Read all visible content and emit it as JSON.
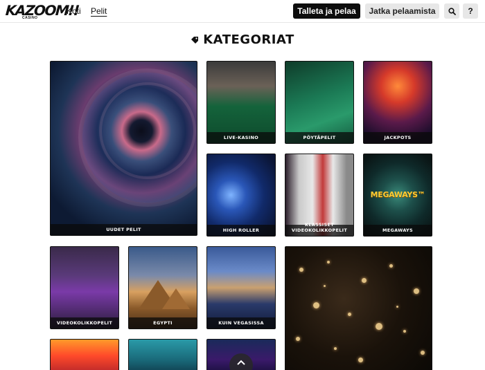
{
  "header": {
    "logo_text": "KAZOOM!!",
    "logo_sub": "CASINO",
    "nav": [
      {
        "label": "Koti"
      },
      {
        "label": "Pelit"
      }
    ],
    "deposit_button": "Talleta ja pelaa",
    "continue_button": "Jatka pelaamista",
    "search_icon": "search-icon",
    "help_label": "?"
  },
  "heading": {
    "icon": "tag-icon",
    "title": "KATEGORIAT"
  },
  "tiles": [
    {
      "label": "UUDET PELIT"
    },
    {
      "label": "LIVE-KASINO"
    },
    {
      "label": "PÖYTÄPELIT"
    },
    {
      "label": "JACKPOTS"
    },
    {
      "label": "HIGH ROLLER"
    },
    {
      "label": "KLASSISET VIDEOKOLIKKOPELIT"
    },
    {
      "label": "MEGAWAYS"
    },
    {
      "label": "VIDEOKOLIKKOPELIT"
    },
    {
      "label": "EGYPTI"
    },
    {
      "label": "KUIN VEGASISSA"
    }
  ],
  "megaways_art_text": "MEGAWAYS™",
  "colors": {
    "primary_button": "#0d0d0d",
    "secondary_button": "#e7e7e7",
    "background": "#ffffff"
  }
}
